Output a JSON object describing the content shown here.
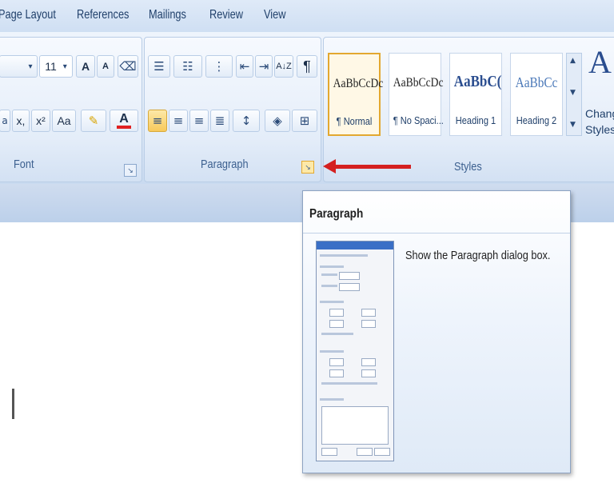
{
  "tabs": [
    "Page Layout",
    "References",
    "Mailings",
    "Review",
    "View"
  ],
  "font_group": {
    "label": "Font",
    "font_size": "11",
    "grow_font": "A",
    "shrink_font": "A",
    "subscript": "x,",
    "superscript": "x²",
    "change_case": "Aa",
    "font_color": "A"
  },
  "paragraph_group": {
    "label": "Paragraph",
    "show_marks": "¶",
    "sort": "A↓Z"
  },
  "styles_group": {
    "label": "Styles",
    "items": [
      {
        "sample": "AaBbCcDc",
        "name": "¶ Normal"
      },
      {
        "sample": "AaBbCcDc",
        "name": "¶ No Spaci..."
      },
      {
        "sample": "AaBbC(",
        "name": "Heading 1"
      },
      {
        "sample": "AaBbCc",
        "name": "Heading 2"
      }
    ],
    "change_styles_line1": "Chang",
    "change_styles_line2": "Styles"
  },
  "tooltip": {
    "title": "Paragraph",
    "description": "Show the Paragraph dialog box."
  },
  "colors": {
    "arrow": "#d42020",
    "highlight": "#f7c95b",
    "font_color_bar": "#e02020"
  }
}
